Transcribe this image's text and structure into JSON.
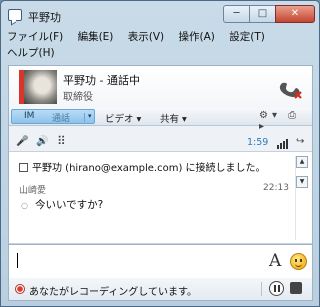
{
  "window": {
    "title": "平野功",
    "minimize_glyph": "─",
    "maximize_glyph": "□",
    "close_glyph": "✕"
  },
  "menu": [
    "ファイル(F)",
    "編集(E)",
    "表示(V)",
    "操作(A)",
    "設定(T)",
    "ヘルプ(H)"
  ],
  "contact": {
    "name_status": "平野功 - 通話中",
    "title": "取締役"
  },
  "toolbar": {
    "im_label": "IM",
    "call_label": "通話",
    "dropdown_glyph": "▾",
    "video_label": "ビデオ ▾",
    "share_label": "共有 ▾",
    "right_icons": "⚙▾ ⎙ ▸"
  },
  "call_controls": {
    "mic_glyph": "🎤",
    "speaker_glyph": "🔊",
    "dialpad_glyph": "⠿",
    "timer": "1:59",
    "transfer_glyph": "↪"
  },
  "conversation": {
    "system_message": "平野功 (hirano@example.com) に接続しました。",
    "sender": "山崎愛",
    "time": "22:13",
    "bullet": "○",
    "message": "今いいですか?"
  },
  "scrollbar": {
    "up_glyph": "▲",
    "down_glyph": "▼"
  },
  "compose": {
    "font_glyph": "A"
  },
  "status": {
    "recording_text": "あなたがレコーディングしています。"
  },
  "colors": {
    "accent_blue": "#2b7bc0",
    "record_red": "#e23b2e",
    "im_tab": "#8fc3ea"
  }
}
